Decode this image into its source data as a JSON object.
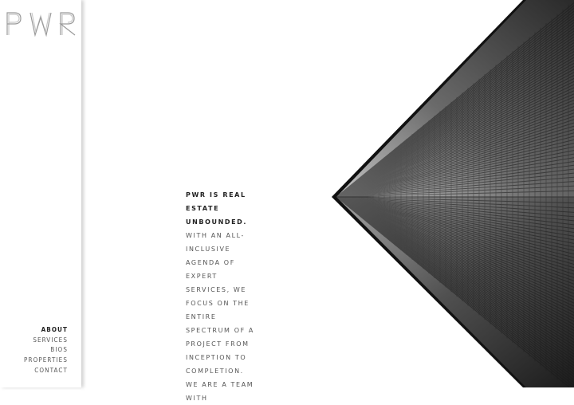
{
  "brand": {
    "logo_text": "PWR"
  },
  "nav": {
    "items": [
      {
        "label": "ABOUT",
        "active": true
      },
      {
        "label": "SERVICES",
        "active": false
      },
      {
        "label": "BIOS",
        "active": false
      },
      {
        "label": "PROPERTIES",
        "active": false
      },
      {
        "label": "CONTACT",
        "active": false
      }
    ]
  },
  "about": {
    "lead": "PWR IS REAL ESTATE UNBOUNDED.",
    "body": "WITH AN ALL-INCLUSIVE AGENDA OF EXPERT SERVICES, WE FOCUS ON THE ENTIRE SPECTRUM OF A PROJECT FROM INCEPTION TO COMPLETION. WE ARE A TEAM WITH"
  },
  "hero": {
    "image": "building-facade-photo"
  },
  "colors": {
    "background": "#ffffff",
    "text": "#555555",
    "text_bold": "#222222",
    "hero_dark": "#111111"
  }
}
